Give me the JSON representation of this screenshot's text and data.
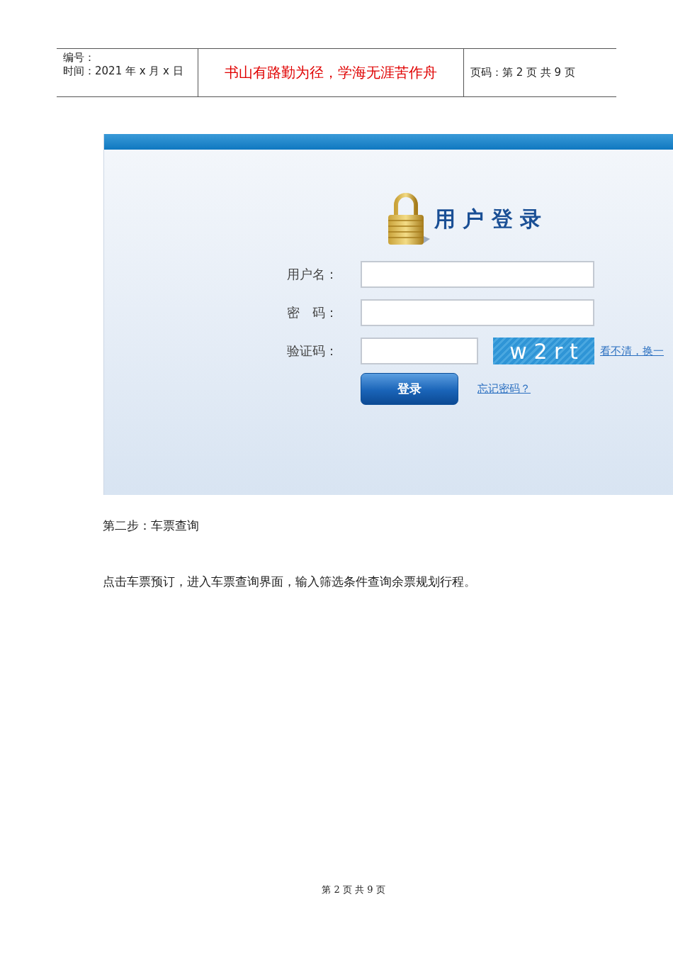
{
  "header": {
    "number_label": "编号：",
    "time": "时间：2021 年 x 月 x 日",
    "motto": "书山有路勤为径，学海无涯苦作舟",
    "page_info": "页码：第 2 页  共 9 页"
  },
  "login": {
    "title": "用 户 登 录",
    "fields": [
      {
        "label": "用户名：",
        "kind": "text"
      },
      {
        "label": "密　码：",
        "kind": "password"
      },
      {
        "label": "验证码：",
        "kind": "captcha",
        "captcha": "w 2 r t",
        "refresh_link": "看不清，换一"
      }
    ],
    "button": "登录",
    "forgot_link": "忘记密码？"
  },
  "step_heading": "第二步：车票查询",
  "paragraph": "点击车票预订，进入车票查询界面，输入筛选条件查询余票规划行程。",
  "footer": "第 2 页 共 9 页"
}
